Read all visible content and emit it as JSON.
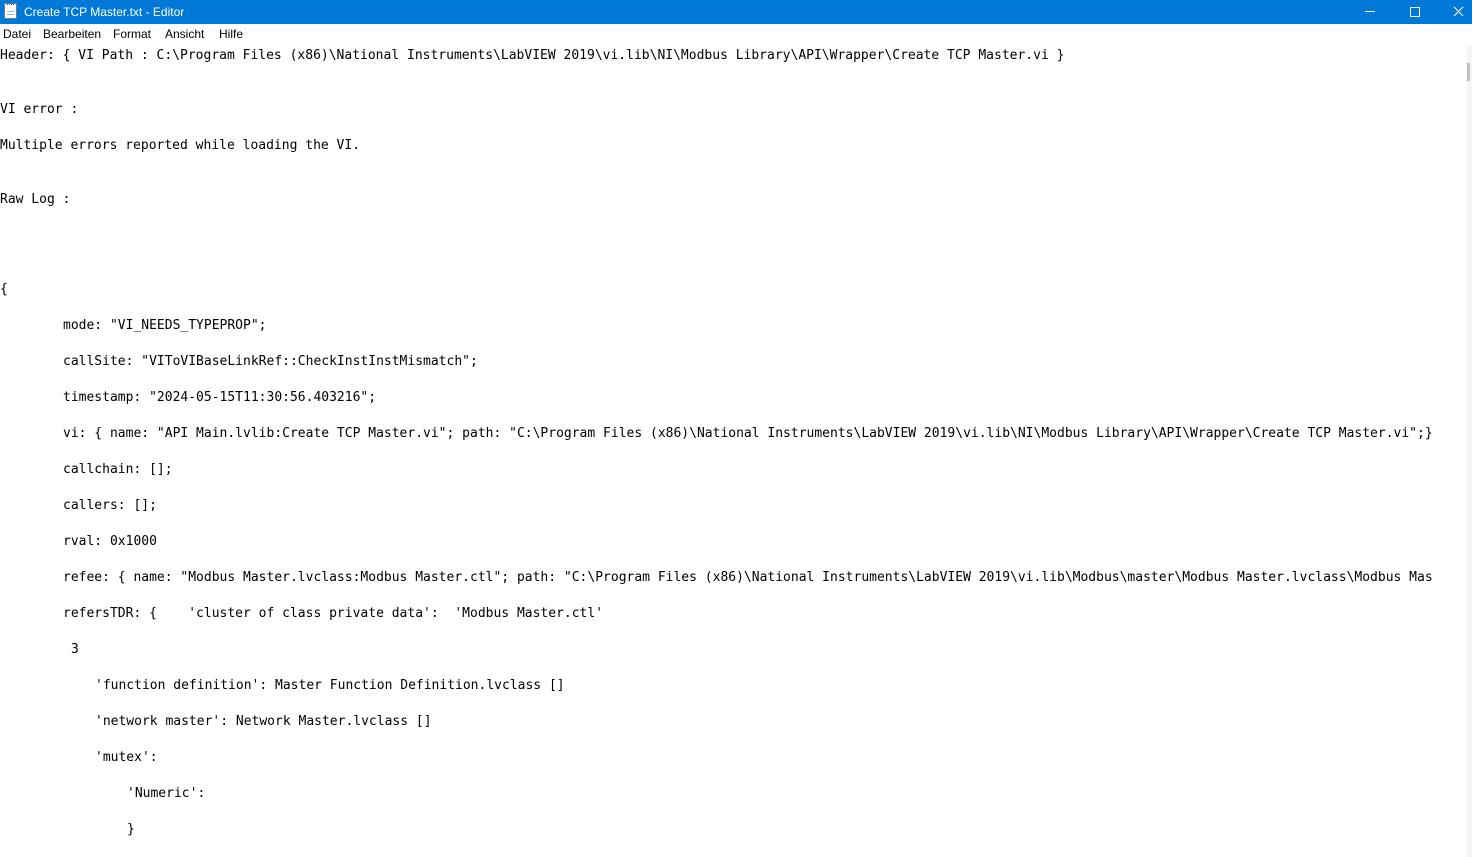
{
  "window": {
    "title": "Create TCP Master.txt - Editor",
    "accent_color": "#0078d7",
    "icon": "notepad-icon",
    "controls": {
      "minimize_icon": "minimize-icon",
      "maximize_icon": "maximize-icon",
      "close_icon": "close-icon"
    }
  },
  "menu": {
    "file": "Datei",
    "edit": "Bearbeiten",
    "format": "Format",
    "view": "Ansicht",
    "help": "Hilfe"
  },
  "editor": {
    "lines": [
      "Header: { VI Path : C:\\Program Files (x86)\\National Instruments\\LabVIEW 2019\\vi.lib\\NI\\Modbus Library\\API\\Wrapper\\Create TCP Master.vi }",
      "VI error :",
      "Multiple errors reported while loading the VI.",
      "Raw Log :",
      "{",
      "mode: \"VI_NEEDS_TYPEPROP\";",
      "callSite: \"VIToVIBaseLinkRef::CheckInstInstMismatch\";",
      "timestamp: \"2024-05-15T11:30:56.403216\";",
      "vi: { name: \"API Main.lvlib:Create TCP Master.vi\"; path: \"C:\\Program Files (x86)\\National Instruments\\LabVIEW 2019\\vi.lib\\NI\\Modbus Library\\API\\Wrapper\\Create TCP Master.vi\";}",
      "callchain: [];",
      "callers: [];",
      "rval: 0x1000",
      "refee: { name: \"Modbus Master.lvclass:Modbus Master.ctl\"; path: \"C:\\Program Files (x86)\\National Instruments\\LabVIEW 2019\\vi.lib\\Modbus\\master\\Modbus Master.lvclass\\Modbus Mas",
      "refersTDR: {    'cluster of class private data':  'Modbus Master.ctl'",
      "3",
      "'function definition': Master Function Definition.lvclass []",
      "'network master': Network Master.lvclass []",
      "'mutex':",
      "'Numeric':",
      "}"
    ]
  }
}
